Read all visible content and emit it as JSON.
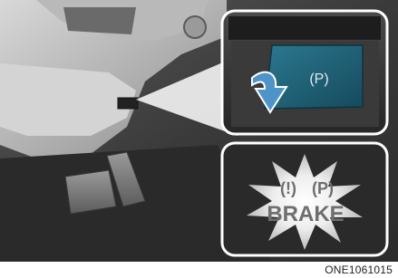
{
  "figure": {
    "code": "ONE1061015",
    "switch_symbol": "(P)",
    "warning_light": {
      "brake_symbol": "(!)",
      "park_symbol": "(P)",
      "label": "BRAKE"
    }
  },
  "colors": {
    "switch_teal": "#1f5f74",
    "pull_arrow": "#4f94c8",
    "glow": "#ffffff",
    "panel_dark": "#2a2a2a"
  },
  "icons": [
    "epb-switch-icon",
    "pull-up-arrow-icon",
    "brake-warning-icon",
    "parking-brake-icon"
  ]
}
